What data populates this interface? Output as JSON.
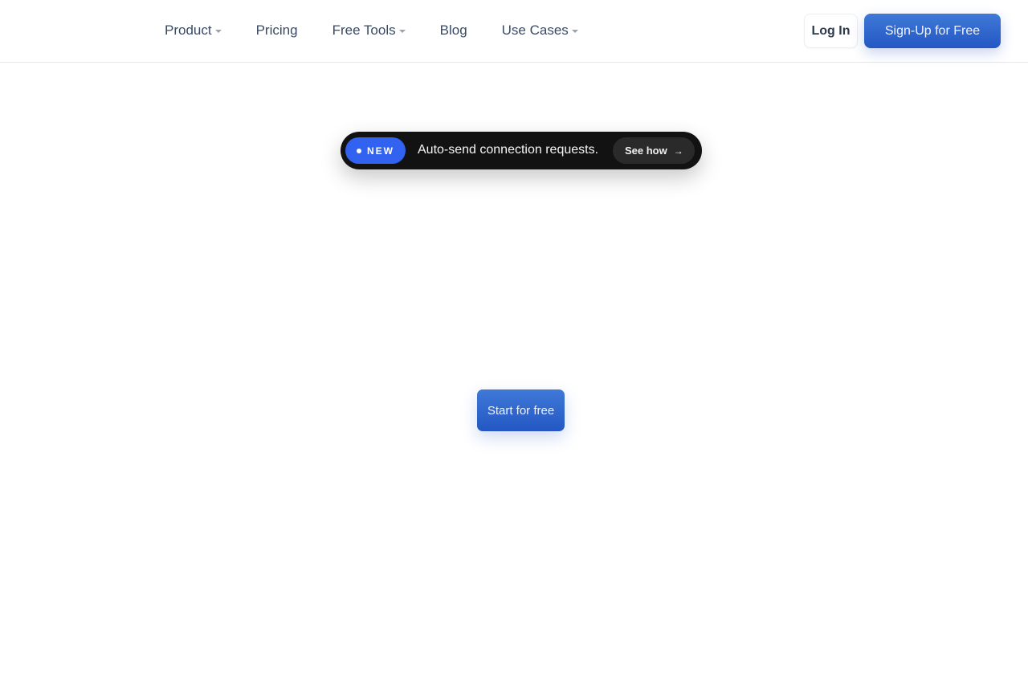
{
  "nav": {
    "items": [
      {
        "label": "Product",
        "has_dropdown": true
      },
      {
        "label": "Pricing",
        "has_dropdown": false
      },
      {
        "label": "Free Tools",
        "has_dropdown": true
      },
      {
        "label": "Blog",
        "has_dropdown": false
      },
      {
        "label": "Use Cases",
        "has_dropdown": true
      }
    ],
    "login_label": "Log In",
    "signup_label": "Sign-Up for Free"
  },
  "announcement": {
    "badge_label": "NEW",
    "text": "Auto-send connection requests.",
    "link_label": "See how",
    "link_icon": "arrow-right-icon"
  },
  "hero": {
    "cta_label": "Start for free"
  },
  "colors": {
    "primary_blue": "#2f68d0",
    "badge_blue": "#3262f0",
    "announcement_bg": "#121212",
    "nav_text": "#3a4a63"
  }
}
